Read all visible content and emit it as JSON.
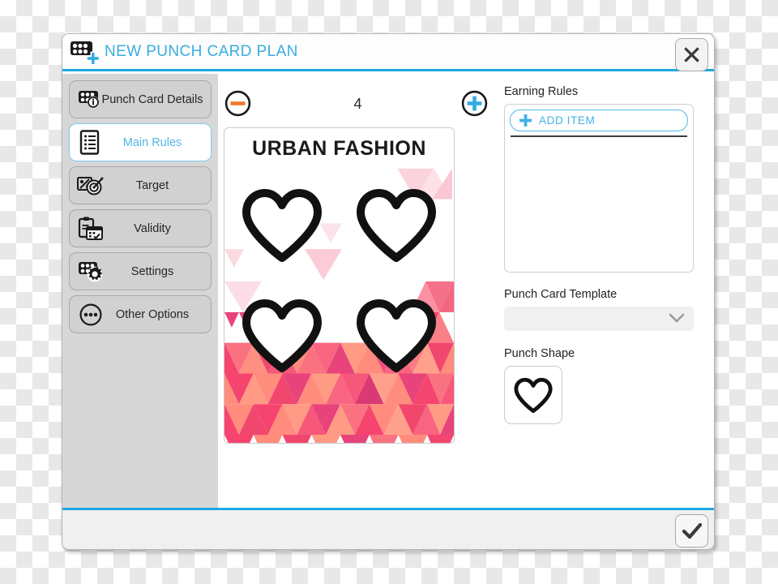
{
  "window": {
    "title": "NEW PUNCH CARD PLAN",
    "title_icon": "punch-card-plus-icon",
    "close_icon": "close-icon",
    "confirm_icon": "checkmark-icon",
    "accent_color": "#1CA9E0",
    "title_color": "#38ADE0"
  },
  "sidebar": {
    "items": [
      {
        "label": "Punch Card Details",
        "icon": "punch-card-info-icon",
        "active": false
      },
      {
        "label": "Main Rules",
        "icon": "list-document-icon",
        "active": true
      },
      {
        "label": "Target",
        "icon": "percent-target-icon",
        "active": false
      },
      {
        "label": "Validity",
        "icon": "clipboard-calendar-icon",
        "active": false
      },
      {
        "label": "Settings",
        "icon": "punch-card-gear-icon",
        "active": false
      },
      {
        "label": "Other Options",
        "icon": "ellipsis-circle-icon",
        "active": false
      }
    ]
  },
  "stepper": {
    "minus_icon": "minus-circle-icon",
    "plus_icon": "plus-circle-icon",
    "value": "4",
    "minus_color": "#F4792A",
    "plus_color": "#31ABE2"
  },
  "punch_card": {
    "title": "URBAN FASHION",
    "punch_shape": "heart",
    "punch_count": 4,
    "background_style": "pink-coral-triangle-mosaic"
  },
  "earning_rules": {
    "label": "Earning Rules",
    "add_item_label": "ADD ITEM",
    "add_item_icon": "plus-icon",
    "items": []
  },
  "punch_card_template": {
    "label": "Punch Card Template",
    "value": "",
    "placeholder": "",
    "chevron_icon": "chevron-down-icon"
  },
  "punch_shape": {
    "label": "Punch Shape",
    "selected_icon": "heart-icon"
  }
}
